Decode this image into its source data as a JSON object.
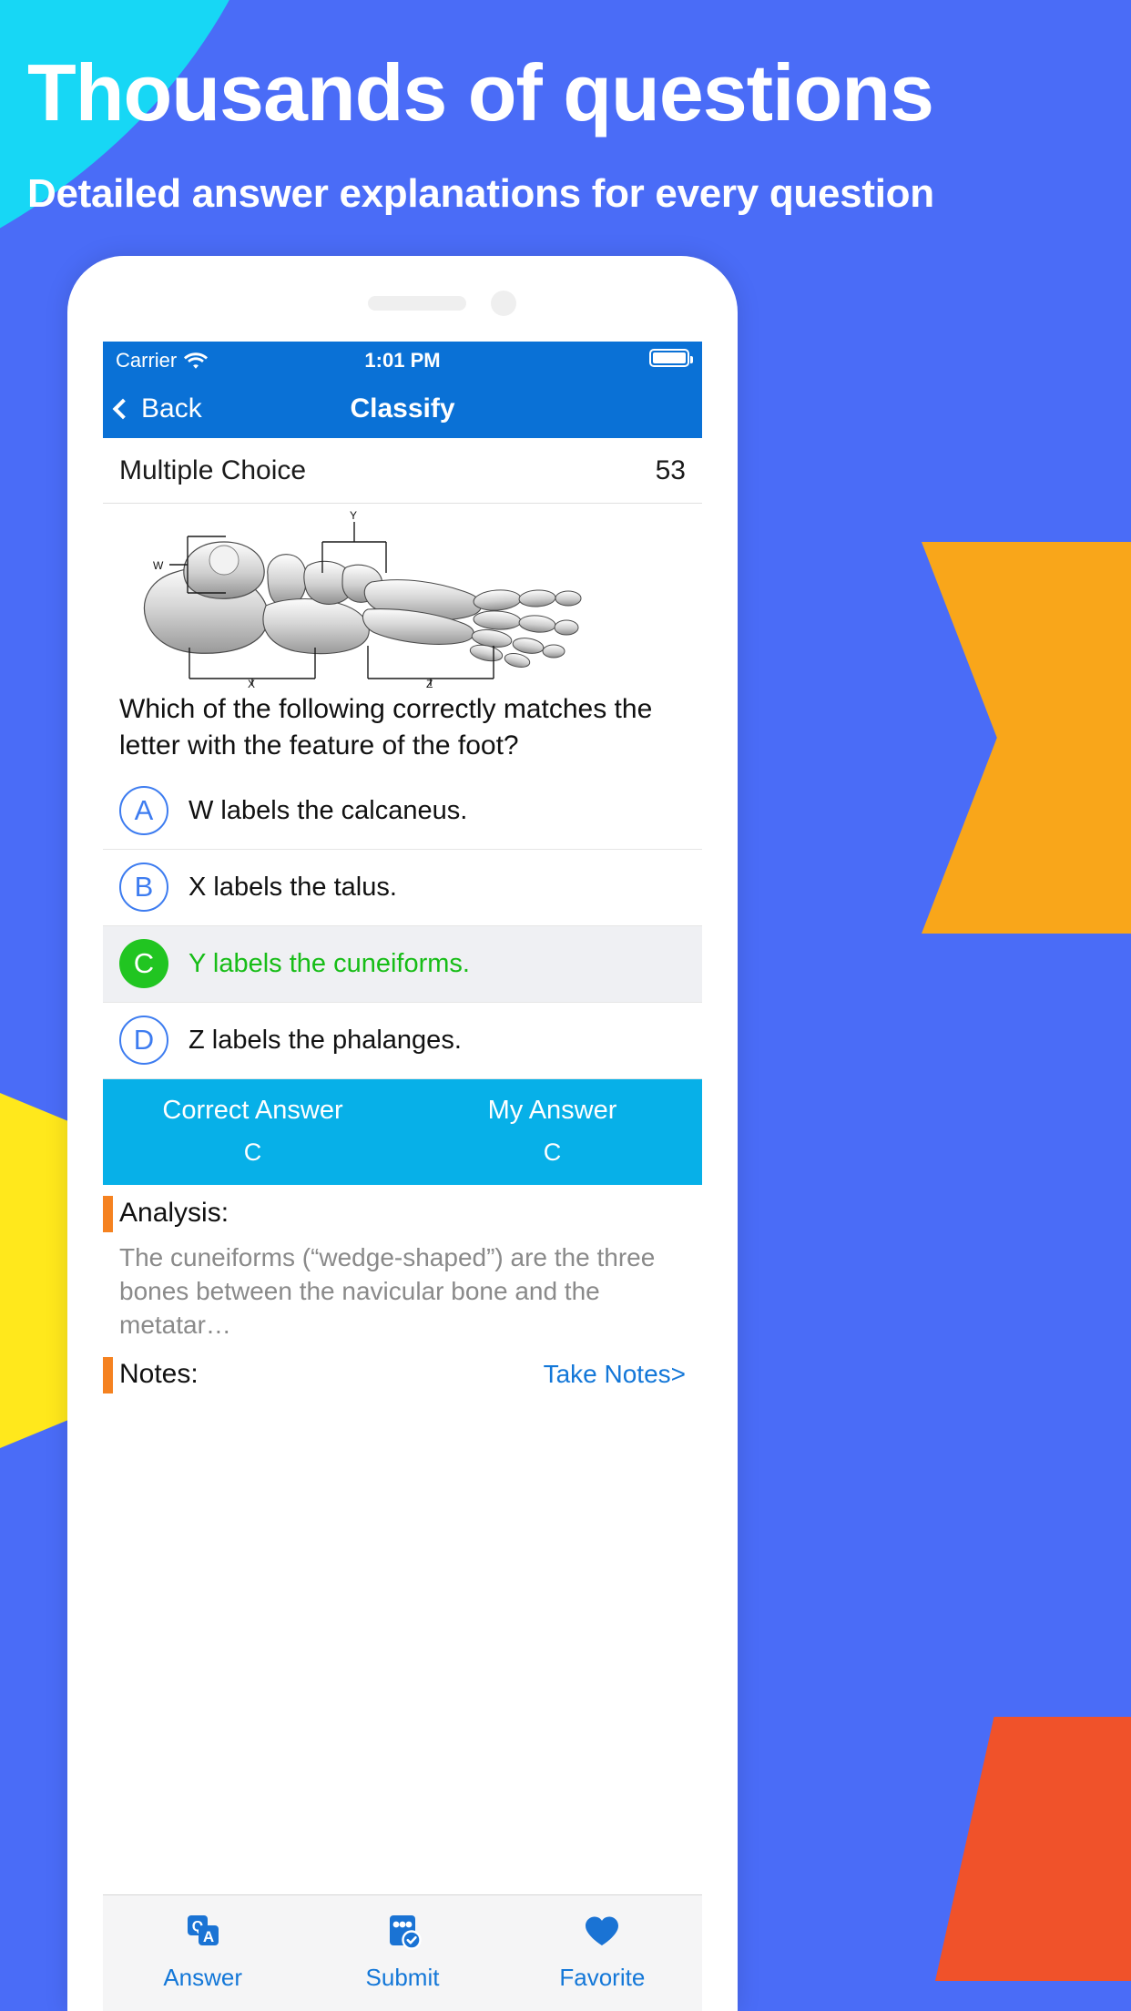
{
  "promo": {
    "headline": "Thousands of questions",
    "subhead": "Detailed answer explanations for every question",
    "colors": {
      "bg": "#4a6cf7",
      "cyan": "#17d7f5",
      "orange": "#f9a61a",
      "red": "#f0522a",
      "yellow": "#ffe81c"
    }
  },
  "statusbar": {
    "carrier": "Carrier",
    "wifi_icon": "wifi-icon",
    "time": "1:01 PM",
    "battery_icon": "battery-full-icon"
  },
  "navbar": {
    "back_label": "Back",
    "back_icon": "chevron-left-icon",
    "title": "Classify",
    "bg": "#0a71d6"
  },
  "meta": {
    "type": "Multiple Choice",
    "number": "53"
  },
  "figure": {
    "name": "foot-bones-diagram",
    "labels": [
      "W",
      "Y",
      "X",
      "Z"
    ]
  },
  "question": {
    "text": "Which of the following correctly matches the letter with the feature of the foot?"
  },
  "options": [
    {
      "letter": "A",
      "text": "W labels the calcaneus.",
      "state": "normal"
    },
    {
      "letter": "B",
      "text": "X labels the talus.",
      "state": "normal"
    },
    {
      "letter": "C",
      "text": "Y labels the cuneiforms.",
      "state": "correct"
    },
    {
      "letter": "D",
      "text": "Z labels the phalanges.",
      "state": "normal"
    }
  ],
  "answer_band": {
    "correct_title": "Correct Answer",
    "correct_value": "C",
    "my_title": "My Answer",
    "my_value": "C",
    "bg": "#07b0e8"
  },
  "analysis": {
    "title": "Analysis:",
    "body": "The cuneiforms (“wedge-shaped”) are the three bones between the navicular bone and the metatar…"
  },
  "notes": {
    "title": "Notes:",
    "link": "Take Notes>"
  },
  "tabbar": {
    "items": [
      {
        "label": "Answer",
        "icon": "qa-answer-icon"
      },
      {
        "label": "Submit",
        "icon": "submit-check-icon"
      },
      {
        "label": "Favorite",
        "icon": "heart-filled-icon"
      }
    ],
    "accent": "#1377d8"
  }
}
